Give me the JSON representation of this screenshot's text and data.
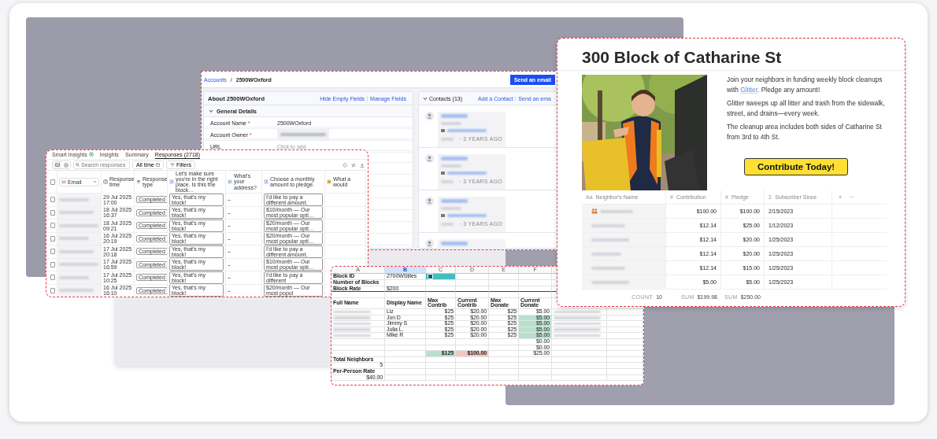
{
  "crm": {
    "breadcrumb": [
      {
        "label": "Accounts",
        "kind": "link"
      },
      {
        "label": "/",
        "kind": "sep"
      },
      {
        "label": "2500WOxford",
        "kind": "current"
      }
    ],
    "send_button": "Send an email",
    "about": {
      "title": "About 2500WOxford",
      "actions": [
        "Hide Empty Fields",
        "Manage Fields"
      ],
      "required_mark": "*",
      "section": {
        "label": "General Details",
        "expanded": true
      },
      "fields": [
        {
          "label": "Account Name",
          "required": true,
          "kind": "text",
          "value": "2500WOxford"
        },
        {
          "label": "Account Owner",
          "required": true,
          "kind": "blurred"
        },
        {
          "label": "URL",
          "required": false,
          "kind": "empty",
          "placeholder": "Click to add"
        }
      ]
    },
    "contacts": {
      "title": "Contacts (13)",
      "expanded": true,
      "actions": [
        "Add a Contact",
        "Send an ema"
      ],
      "items": [
        {
          "kind": "full",
          "last_contacted": "· 3 YEARS AGO"
        },
        {
          "kind": "full",
          "last_contacted": "· 3 YEARS AGO"
        },
        {
          "kind": "full",
          "last_contacted": "· 3 YEARS AGO"
        },
        {
          "kind": "partial"
        }
      ]
    }
  },
  "responses": {
    "tabs": [
      {
        "label": "Smart Insights",
        "kind": "smart",
        "selected": false
      },
      {
        "label": "Insights",
        "kind": "plain",
        "selected": false
      },
      {
        "label": "Summary",
        "kind": "plain",
        "selected": false
      },
      {
        "label": "Responses (2718)",
        "kind": "plain",
        "selected": true
      }
    ],
    "search": {
      "placeholder": "Search responses"
    },
    "date_filter": "All time",
    "filter_button": "Filters",
    "all_checked": false,
    "columns": [
      {
        "label": "Email",
        "kind": "email"
      },
      {
        "label": "Response time",
        "kind": "time"
      },
      {
        "label": "Response type",
        "kind": "type"
      },
      {
        "label": "Let's make sure you're in the right place. Is this the block…",
        "kind": "choice"
      },
      {
        "label": "What's your address?",
        "kind": "text"
      },
      {
        "label": "Choose a monthly amount to pledge.",
        "kind": "choice"
      },
      {
        "label": "What a would",
        "kind": "number"
      }
    ],
    "rows": [
      {
        "checked": false,
        "time": "29 Jul 2025 17:00",
        "type": "Completed",
        "block": "Yes, that's my block!",
        "address": "–",
        "pledge": "I'd like to pay a different amount."
      },
      {
        "checked": false,
        "time": "18 Jul 2025 16:37",
        "type": "Completed",
        "block": "Yes, that's my block!",
        "address": "–",
        "pledge": "$10/month — Our most popular opti…"
      },
      {
        "checked": false,
        "time": "18 Jul 2025 09:21",
        "type": "Completed",
        "block": "Yes, that's my block!",
        "address": "–",
        "pledge": "$20/month — Our most popular opti…"
      },
      {
        "checked": false,
        "time": "16 Jul 2025 20:19",
        "type": "Completed",
        "block": "Yes, that's my block!",
        "address": "–",
        "pledge": "$20/month — Our most popular opti…"
      },
      {
        "checked": false,
        "time": "17 Jul 2025 20:18",
        "type": "Completed",
        "block": "Yes, that's my block!",
        "address": "–",
        "pledge": "I'd like to pay a different amount."
      },
      {
        "checked": false,
        "time": "17 Jul 2025 16:59",
        "type": "Completed",
        "block": "Yes, that's my block!",
        "address": "–",
        "pledge": "$10/month — Our most popular opti…"
      },
      {
        "checked": false,
        "time": "17 Jul 2025 10:25",
        "type": "Completed",
        "block": "Yes, that's my block!",
        "address": "–",
        "pledge": "I'd like to pay a different"
      },
      {
        "checked": false,
        "time": "16 Jul 2025 16:10",
        "type": "Completed",
        "block": "Yes, that's my block!",
        "address": "–",
        "pledge": "$20/month — Our most popul"
      }
    ]
  },
  "sheet": {
    "columns": [
      {
        "label": "A",
        "selected": false
      },
      {
        "label": "B",
        "selected": true
      },
      {
        "label": "C",
        "selected": false
      },
      {
        "label": "D",
        "selected": false
      },
      {
        "label": "E",
        "selected": false
      },
      {
        "label": "F",
        "selected": false
      }
    ],
    "rows": [
      {
        "cells": [
          {
            "kind": "label",
            "text": "Block ID"
          },
          {
            "kind": "text",
            "text": "2700WStiles"
          },
          {
            "kind": "checkbox",
            "checked": true,
            "color": "#3fbfbf"
          }
        ]
      },
      {
        "cells": [
          {
            "kind": "label",
            "text": "Number of Blocks"
          }
        ]
      },
      {
        "rule_below": true,
        "cells": [
          {
            "kind": "label",
            "text": "Block Rate"
          },
          {
            "kind": "text",
            "text": "$200"
          }
        ]
      },
      {
        "cells": [
          ""
        ]
      },
      {
        "cells": [
          {
            "kind": "label",
            "text": "Full Name"
          },
          {
            "kind": "label",
            "text": "Display Name"
          },
          {
            "kind": "label",
            "text": "Max Contrib"
          },
          {
            "kind": "label",
            "text": "Current Contrib"
          },
          {
            "kind": "label",
            "text": "Max Donate"
          },
          {
            "kind": "label",
            "text": "Current Donate"
          }
        ]
      },
      {
        "cells": [
          {
            "kind": "blurred"
          },
          {
            "kind": "text",
            "text": "Liz"
          },
          {
            "kind": "number",
            "text": "$25"
          },
          {
            "kind": "number",
            "text": "$20.00"
          },
          {
            "kind": "number",
            "text": "$25"
          },
          {
            "kind": "number",
            "text": "$5.00"
          },
          {
            "kind": "blurred"
          }
        ]
      },
      {
        "cells": [
          {
            "kind": "blurred"
          },
          {
            "kind": "text",
            "text": "Jon D"
          },
          {
            "kind": "number",
            "text": "$25"
          },
          {
            "kind": "number",
            "text": "$20.00"
          },
          {
            "kind": "number",
            "text": "$25"
          },
          {
            "kind": "number",
            "text": "$5.00",
            "color": "#b7e1cd"
          },
          {
            "kind": "blurred"
          }
        ]
      },
      {
        "cells": [
          {
            "kind": "blurred"
          },
          {
            "kind": "text",
            "text": "Jimmy S"
          },
          {
            "kind": "number",
            "text": "$25"
          },
          {
            "kind": "number",
            "text": "$20.00"
          },
          {
            "kind": "number",
            "text": "$25"
          },
          {
            "kind": "number",
            "text": "$5.00",
            "color": "#b7e1cd"
          },
          {
            "kind": "blurred"
          }
        ]
      },
      {
        "cells": [
          {
            "kind": "blurred"
          },
          {
            "kind": "text",
            "text": "Julia L."
          },
          {
            "kind": "number",
            "text": "$25"
          },
          {
            "kind": "number",
            "text": "$20.00"
          },
          {
            "kind": "number",
            "text": "$25"
          },
          {
            "kind": "number",
            "text": "$5.00",
            "color": "#b7e1cd"
          },
          {
            "kind": "blurred"
          }
        ]
      },
      {
        "cells": [
          {
            "kind": "blurred"
          },
          {
            "kind": "text",
            "text": "Mike R"
          },
          {
            "kind": "number",
            "text": "$25"
          },
          {
            "kind": "number",
            "text": "$20.00"
          },
          {
            "kind": "number",
            "text": "$25"
          },
          {
            "kind": "number",
            "text": "$5.00",
            "color": "#b7e1cd"
          },
          {
            "kind": "blurred"
          }
        ]
      },
      {
        "cells": [
          "",
          "",
          "",
          "",
          "",
          {
            "kind": "number",
            "text": "$0.00"
          }
        ]
      },
      {
        "cells": [
          "",
          "",
          "",
          "",
          "",
          {
            "kind": "number",
            "text": "$0.00"
          }
        ]
      },
      {
        "cells": [
          "",
          "",
          {
            "kind": "total",
            "text": "$125",
            "color": "#b7e1cd"
          },
          {
            "kind": "total",
            "text": "$100.00",
            "color": "#f4c7c3"
          },
          "",
          {
            "kind": "number",
            "text": "$25.00"
          }
        ]
      },
      {
        "cells": [
          {
            "kind": "label",
            "text": "Total Neighbors"
          }
        ]
      },
      {
        "cells": [
          {
            "kind": "number",
            "text": "5"
          }
        ]
      },
      {
        "cells": [
          {
            "kind": "label",
            "text": "Per-Person Rate"
          }
        ]
      },
      {
        "cells": [
          {
            "kind": "number",
            "text": "$40.00"
          }
        ]
      }
    ]
  },
  "page": {
    "title": "300 Block of Catharine St",
    "paragraphs": [
      [
        {
          "text": "Join your neighbors in funding weekly block cleanups with "
        },
        {
          "text": "Glitter",
          "kind": "link"
        },
        {
          "text": ". Pledge any amount!"
        }
      ],
      [
        {
          "text": "Glitter sweeps up all litter and trash from the sidewalk, street, and drains—every week."
        }
      ],
      [
        {
          "text": "The cleanup area includes both sides of Catharine St from 3rd to 4th St."
        }
      ]
    ],
    "button": "Contribute Today!",
    "table": {
      "columns": [
        {
          "glyph": "Aa",
          "label": "Neighbor's Name"
        },
        {
          "glyph": "#",
          "label": "Contribution"
        },
        {
          "glyph": "#",
          "label": "Pledge"
        },
        {
          "glyph": "Σ",
          "label": "Subscriber Since"
        }
      ],
      "add_column": "+",
      "more": "···",
      "rows": [
        {
          "kind": "group",
          "contribution": "$100.00",
          "pledge": "$100.00",
          "since": "2/15/2023"
        },
        {
          "kind": "person",
          "contribution": "$12.14",
          "pledge": "$25.00",
          "since": "1/12/2023"
        },
        {
          "kind": "person",
          "contribution": "$12.14",
          "pledge": "$20.00",
          "since": "1/25/2023"
        },
        {
          "kind": "person",
          "contribution": "$12.14",
          "pledge": "$20.00",
          "since": "1/25/2023"
        },
        {
          "kind": "person",
          "contribution": "$12.14",
          "pledge": "$15.00",
          "since": "1/25/2023"
        },
        {
          "kind": "person",
          "contribution": "$5.00",
          "pledge": "$5.00",
          "since": "1/25/2023"
        }
      ],
      "footer": [
        {
          "label": "COUNT",
          "value": "10"
        },
        {
          "label": "SUM",
          "value": "$199.98"
        },
        {
          "label": "SUM",
          "value": "$250.00"
        }
      ]
    }
  }
}
